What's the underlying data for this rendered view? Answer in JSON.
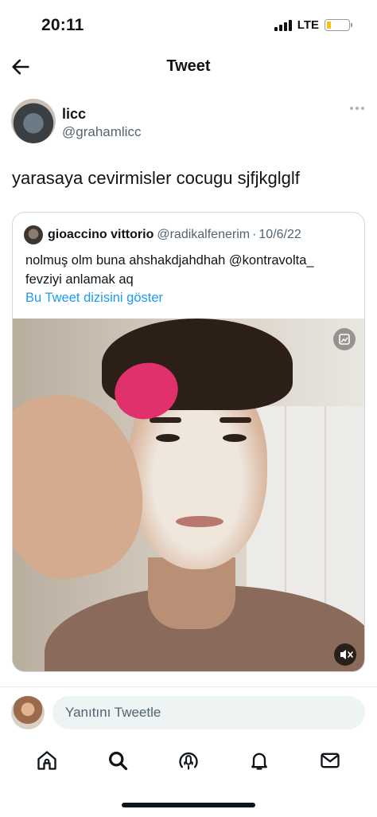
{
  "status_bar": {
    "time": "20:11",
    "network": "LTE"
  },
  "header": {
    "title": "Tweet"
  },
  "tweet": {
    "author_name": "licc",
    "author_handle": "@grahamlicc",
    "text": "yarasaya cevirmisler cocugu sjfjkglglf"
  },
  "quoted_tweet": {
    "author_name": "gioaccino vittorio",
    "author_handle": "@radikalfenerim",
    "separator": "·",
    "date": "10/6/22",
    "text": "nolmuş olm buna ahshakdjahdhah @kontravolta_ fevziyi anlamak aq",
    "thread_link": "Bu Tweet dizisini göster"
  },
  "reply": {
    "placeholder": "Yanıtını Tweetle"
  },
  "tabs": [
    {
      "icon": "home-icon"
    },
    {
      "icon": "search-icon"
    },
    {
      "icon": "spaces-icon"
    },
    {
      "icon": "notifications-icon"
    },
    {
      "icon": "messages-icon"
    }
  ],
  "colors": {
    "accent": "#1d9bf0",
    "text": "#0f1419",
    "secondary": "#536471",
    "border": "#cfd9de"
  }
}
